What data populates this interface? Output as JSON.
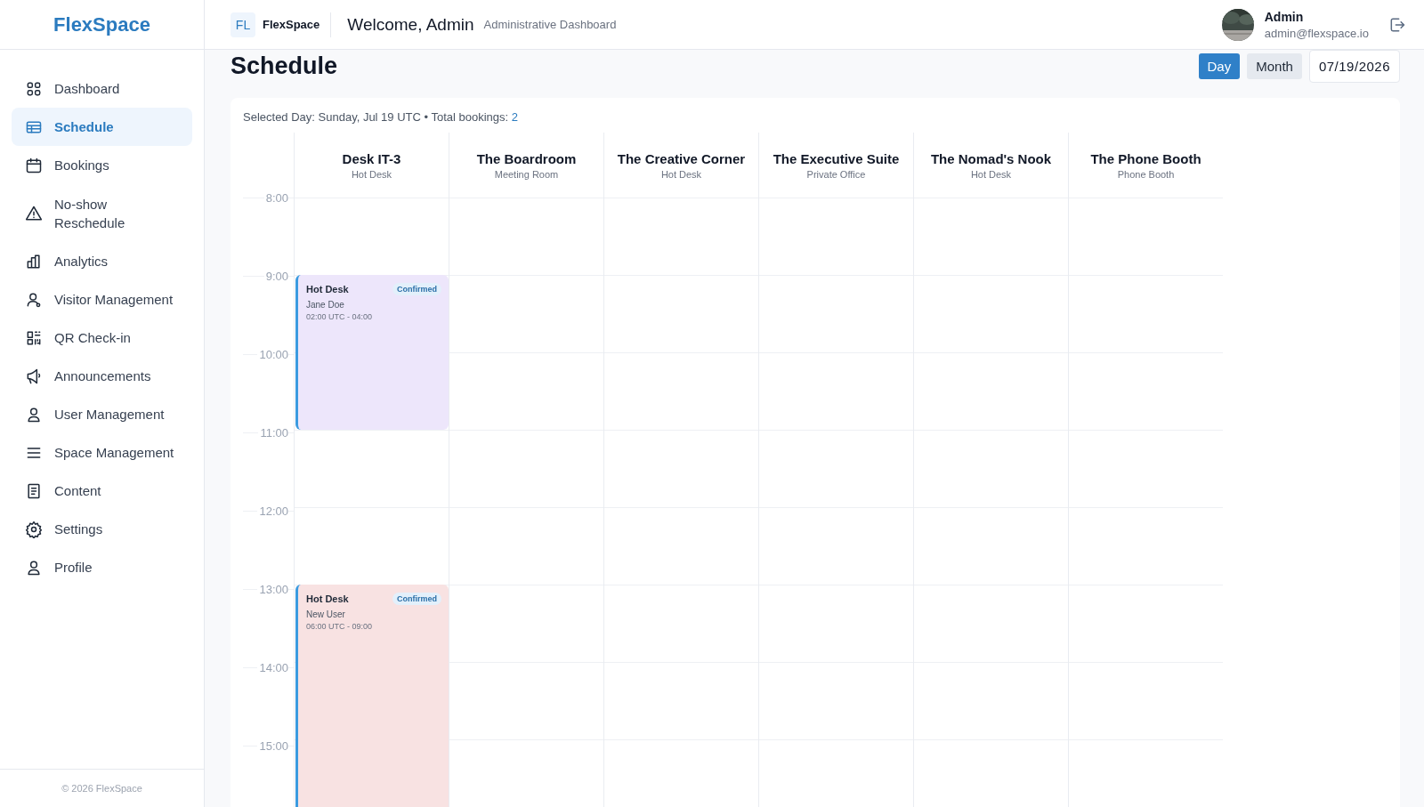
{
  "sidebar": {
    "logo": "FlexSpace",
    "items": [
      {
        "label": "Dashboard",
        "selected": false
      },
      {
        "label": "Schedule",
        "selected": true
      },
      {
        "label": "Bookings",
        "selected": false
      },
      {
        "label": "No-show Reschedule",
        "selected": false
      },
      {
        "label": "Analytics",
        "selected": false
      },
      {
        "label": "Visitor Management",
        "selected": false
      },
      {
        "label": "QR Check-in",
        "selected": false
      },
      {
        "label": "Announcements",
        "selected": false
      },
      {
        "label": "User Management",
        "selected": false
      },
      {
        "label": "Space Management",
        "selected": false
      },
      {
        "label": "Content",
        "selected": false
      },
      {
        "label": "Settings",
        "selected": false
      },
      {
        "label": "Profile",
        "selected": false
      }
    ],
    "footer": "© 2026 FlexSpace"
  },
  "header": {
    "org_badge": "FL",
    "org_name": "FlexSpace",
    "title": "Welcome, Admin",
    "subtitle": "Administrative Dashboard",
    "user": {
      "name": "Admin",
      "email": "admin@flexspace.io"
    }
  },
  "page": {
    "title": "Schedule",
    "views": [
      {
        "label": "Day",
        "selected": true
      },
      {
        "label": "Month",
        "selected": false
      }
    ],
    "date": "07/19/2026"
  },
  "schedule": {
    "summary": "Selected Day: Sunday, Jul 19 UTC • Total bookings: ",
    "total": "2",
    "hours": [
      "8:00",
      "9:00",
      "10:00",
      "11:00",
      "12:00",
      "13:00",
      "14:00",
      "15:00"
    ],
    "columns": [
      {
        "name": "Desk IT-3",
        "type": "Hot Desk",
        "events": [
          {
            "title": "Hot Desk",
            "status": "Confirmed",
            "person": "Jane Doe",
            "time": "02:00 UTC - 04:00",
            "color": "#ede6fb"
          },
          {
            "title": "Hot Desk",
            "status": "Confirmed",
            "person": "New User",
            "time": "06:00 UTC - 09:00",
            "color": "#f8e2e2"
          }
        ]
      },
      {
        "name": "The Boardroom",
        "type": "Meeting Room"
      },
      {
        "name": "The Creative Corner",
        "type": "Hot Desk"
      },
      {
        "name": "The Executive Suite",
        "type": "Private Office"
      },
      {
        "name": "The Nomad's Nook",
        "type": "Hot Desk"
      },
      {
        "name": "The Phone Booth",
        "type": "Phone Booth"
      }
    ]
  }
}
